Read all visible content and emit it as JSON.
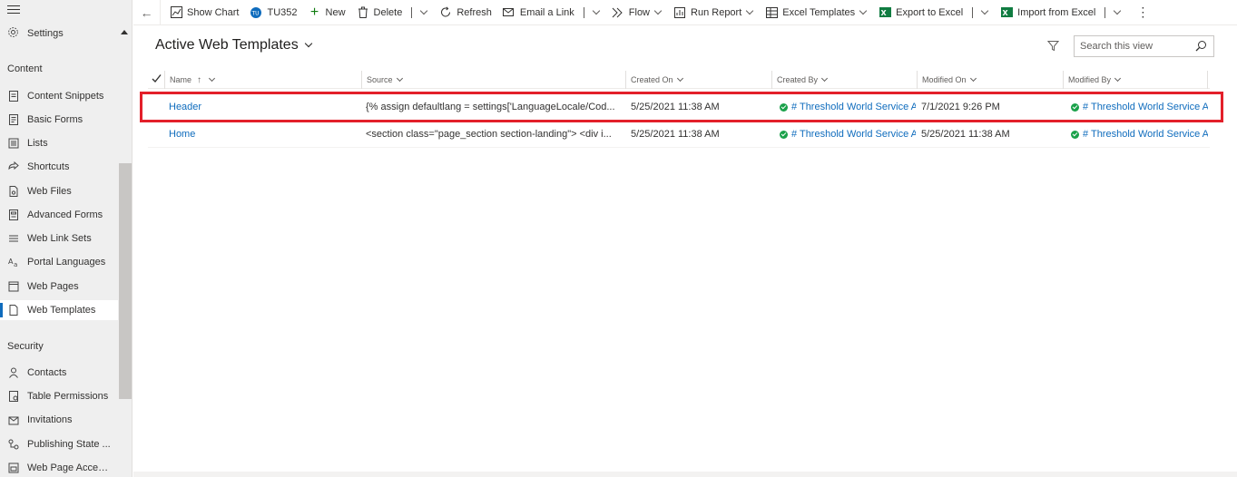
{
  "sidebar": {
    "settings_label": "Settings",
    "sections": [
      {
        "title": "Content"
      },
      {
        "title": "Security"
      }
    ],
    "content_items": [
      {
        "label": "Content Snippets",
        "icon": "document-text-icon"
      },
      {
        "label": "Basic Forms",
        "icon": "form-icon"
      },
      {
        "label": "Lists",
        "icon": "list-icon"
      },
      {
        "label": "Shortcuts",
        "icon": "shortcut-icon"
      },
      {
        "label": "Web Files",
        "icon": "file-icon"
      },
      {
        "label": "Advanced Forms",
        "icon": "advanced-form-icon"
      },
      {
        "label": "Web Link Sets",
        "icon": "link-set-icon"
      },
      {
        "label": "Portal Languages",
        "icon": "language-icon"
      },
      {
        "label": "Web Pages",
        "icon": "web-page-icon"
      },
      {
        "label": "Web Templates",
        "icon": "web-template-icon",
        "selected": true
      }
    ],
    "security_items": [
      {
        "label": "Contacts",
        "icon": "person-icon"
      },
      {
        "label": "Table Permissions",
        "icon": "permission-icon"
      },
      {
        "label": "Invitations",
        "icon": "invitation-icon"
      },
      {
        "label": "Publishing State ...",
        "icon": "publishing-icon"
      },
      {
        "label": "Web Page Access...",
        "icon": "access-icon"
      }
    ]
  },
  "toolbar": {
    "show_chart": "Show Chart",
    "tu352": "TU352",
    "new": "New",
    "delete": "Delete",
    "refresh": "Refresh",
    "email_link": "Email a Link",
    "flow": "Flow",
    "run_report": "Run Report",
    "excel_templates": "Excel Templates",
    "export_excel": "Export to Excel",
    "import_excel": "Import from Excel",
    "more": "⋮"
  },
  "view": {
    "title": "Active Web Templates",
    "search_placeholder": "Search this view"
  },
  "grid": {
    "columns": [
      {
        "label": "Name",
        "sorted": "↑"
      },
      {
        "label": "Source"
      },
      {
        "label": "Created On"
      },
      {
        "label": "Created By"
      },
      {
        "label": "Modified On"
      },
      {
        "label": "Modified By"
      }
    ],
    "rows": [
      {
        "name": "Header",
        "source": "{% assign defaultlang = settings['LanguageLocale/Cod...",
        "created_on": "5/25/2021 11:38 AM",
        "created_by": "# Threshold World Service Acc",
        "modified_on": "7/1/2021 9:26 PM",
        "modified_by": "# Threshold World Service Acc"
      },
      {
        "name": "Home",
        "source": "<section class=\"page_section section-landing\"> <div i...",
        "created_on": "5/25/2021 11:38 AM",
        "created_by": "# Threshold World Service Acc",
        "modified_on": "5/25/2021 11:38 AM",
        "modified_by": "# Threshold World Service Acc"
      }
    ]
  },
  "colors": {
    "accent": "#0f6cbd",
    "highlight": "#e3202a",
    "status_ok": "#1aa14a"
  }
}
